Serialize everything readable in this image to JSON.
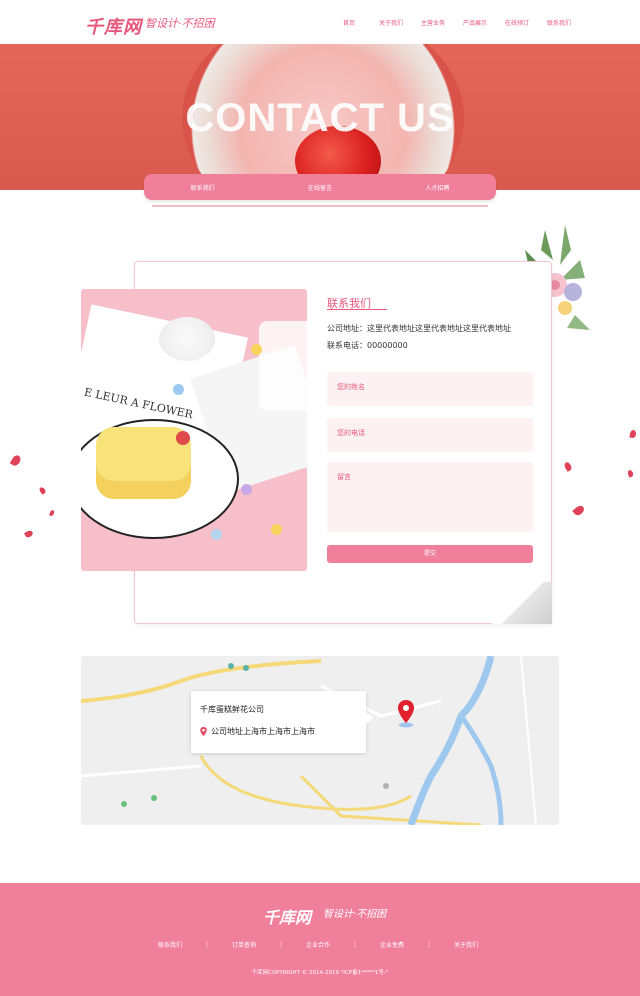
{
  "header": {
    "logo": "千库网",
    "slogan": "智设计·不招困",
    "nav": [
      "首页",
      "关于我们",
      "主营业务",
      "产品展示",
      "在线预订",
      "联系我们"
    ]
  },
  "banner": {
    "title": "CONTACT US"
  },
  "subtabs": [
    "联系我们",
    "在线留言",
    "人才招聘"
  ],
  "contact": {
    "section_title": "联系我们",
    "address": "公司地址：这里代表地址这里代表地址这里代表地址",
    "phone": "联系电话：00000000",
    "form": {
      "name_placeholder": "您的姓名",
      "phone_placeholder": "您的电话",
      "message_placeholder": "留言",
      "submit_label": "提交"
    },
    "photo_text": "E LEUR A FLOWER"
  },
  "map": {
    "company": "千库蛋糕鲜花公司",
    "address": "公司地址上海市上海市上海市"
  },
  "footer": {
    "logo": "千库网",
    "slogan": "智设计·不招困",
    "links": [
      "联系我们",
      "订单查询",
      "企业合作",
      "企业免费",
      "关于我们"
    ],
    "copyright": "千库网COPYRIGHT © 2014-2019 \"ICP备1*****1号-\""
  },
  "colors": {
    "accent": "#e8577c",
    "pink_bar": "#f07f9c",
    "banner_bg": "#e4675a"
  }
}
